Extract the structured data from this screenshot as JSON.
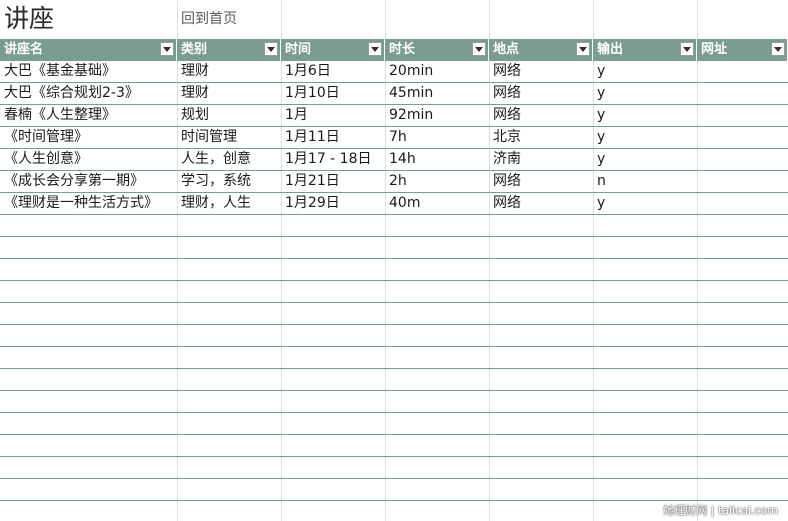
{
  "sheet": {
    "title": "讲座",
    "home_link": "回到首页",
    "columns": [
      "讲座名",
      "类别",
      "时间",
      "时长",
      "地点",
      "输出",
      "网址"
    ],
    "rows": [
      [
        "大巴《基金基础》",
        "理财",
        "1月6日",
        "20min",
        "网络",
        "y"
      ],
      [
        "大巴《综合规划2-3》",
        "理财",
        "1月10日",
        "45min",
        "网络",
        "y"
      ],
      [
        "春楠《人生整理》",
        "规划",
        "1月",
        "92min",
        "网络",
        "y"
      ],
      [
        "《时间管理》",
        "时间管理",
        "1月11日",
        "7h",
        "北京",
        "y"
      ],
      [
        "《人生创意》",
        "人生，创意",
        "1月17 - 18日",
        "14h",
        "济南",
        "y"
      ],
      [
        "《成长会分享第一期》",
        "学习，系统",
        "1月21日",
        "2h",
        "网络",
        "n"
      ],
      [
        "《理财是一种生活方式》",
        "理财，人生",
        "1月29日",
        "40m",
        "网络",
        "y"
      ]
    ],
    "empty_row_count": 14
  },
  "watermark": "她理财网 | talicai.com",
  "colors": {
    "header_bg": "#7b9c90",
    "header_text": "#ffffff",
    "row_border": "#7b9c90",
    "grid_line": "#d9dfe5"
  }
}
